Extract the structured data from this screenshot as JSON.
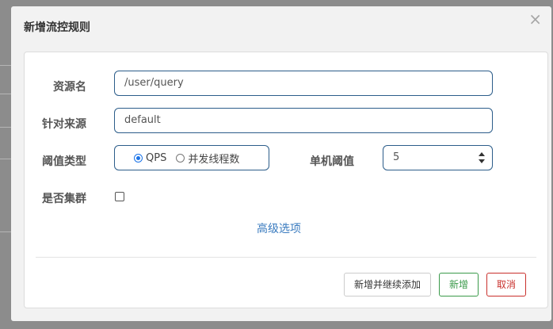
{
  "dialog": {
    "title": "新增流控规则",
    "close_symbol": "×"
  },
  "form": {
    "resource_name": {
      "label": "资源名",
      "value": "/user/query"
    },
    "limit_app": {
      "label": "针对来源",
      "value": "default"
    },
    "threshold_type": {
      "label": "阈值类型",
      "options": [
        "QPS",
        "并发线程数"
      ],
      "selected": "QPS"
    },
    "single_threshold": {
      "label": "单机阈值",
      "value": "5"
    },
    "cluster_mode": {
      "label": "是否集群",
      "checked": false
    },
    "advanced_link": "高级选项"
  },
  "buttons": {
    "add_and_continue": "新增并继续添加",
    "add": "新增",
    "cancel": "取消"
  },
  "colors": {
    "input_border": "#2c5d8a",
    "link": "#3a7bbf",
    "success": "#3a9a4a",
    "danger": "#c9302c",
    "radio_selected": "#1a73e8"
  }
}
